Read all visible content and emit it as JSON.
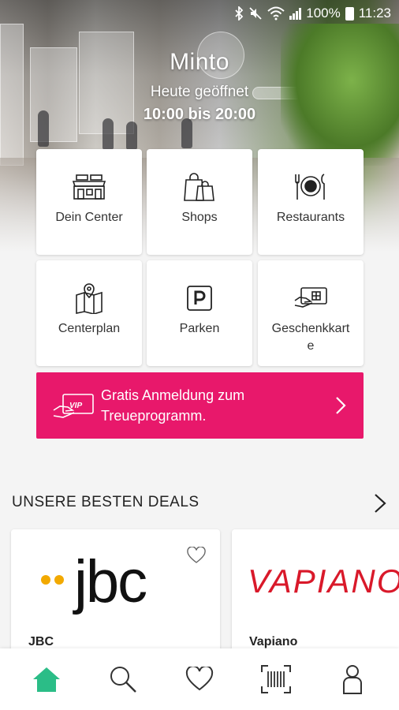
{
  "status_bar": {
    "battery": "100%",
    "time": "11:23",
    "icons": [
      "bluetooth-icon",
      "mute-icon",
      "wifi-icon",
      "signal-icon",
      "battery-icon"
    ]
  },
  "header": {
    "title": "Minto",
    "open_label": "Heute geöffnet",
    "hours": "10:00 bis 20:00"
  },
  "tiles": [
    {
      "label": "Dein Center",
      "icon": "center-icon"
    },
    {
      "label": "Shops",
      "icon": "shopping-bags-icon"
    },
    {
      "label": "Restaurants",
      "icon": "plate-cutlery-icon"
    },
    {
      "label": "Centerplan",
      "icon": "map-pin-icon"
    },
    {
      "label": "Parken",
      "icon": "parking-icon"
    },
    {
      "label": "Geschenkkarte",
      "icon": "gift-card-icon"
    }
  ],
  "vip_banner": {
    "text": "Gratis Anmeldung zum Treueprogramm.",
    "badge": "VIP",
    "accent": "#e8186b"
  },
  "deals": {
    "title": "UNSERE BESTEN DEALS",
    "cards": [
      {
        "name": "JBC",
        "logo_text": "jbc"
      },
      {
        "name": "Vapiano",
        "logo_text": "VAPIANO"
      }
    ]
  },
  "bottom_nav": {
    "active_color": "#2bbd87",
    "items": [
      "home-icon",
      "search-icon",
      "heart-icon",
      "barcode-scan-icon",
      "profile-icon"
    ]
  }
}
